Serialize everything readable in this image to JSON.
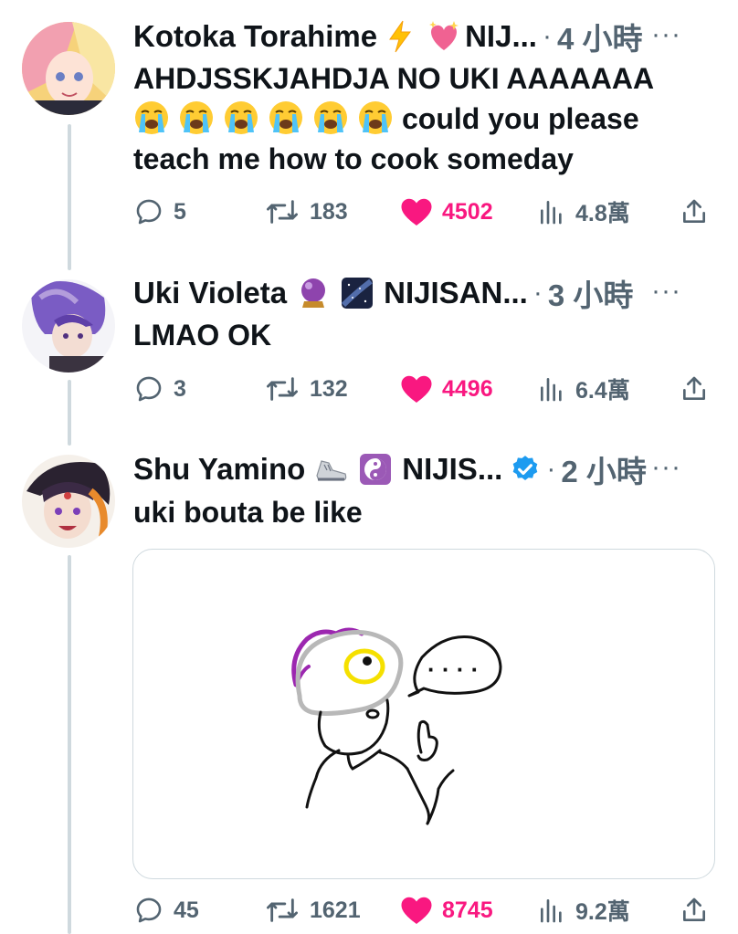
{
  "tweets": [
    {
      "name": "Kotoka Torahime",
      "badges": [
        "lightning-emoji",
        "sparkling-heart-emoji"
      ],
      "handle": "NIJ...",
      "dot": "·",
      "time": "4 小時",
      "more": "···",
      "text_line1": "AHDJSSKJAHDJA NO UKI AAAAAAA",
      "text_after_emojis": "could you please",
      "text_line3": "teach me how to cook someday",
      "emoji_count": 6,
      "replies": "5",
      "reposts": "183",
      "likes": "4502",
      "views": "4.8萬"
    },
    {
      "name": "Uki Violeta",
      "badges": [
        "crystal-ball-emoji",
        "milky-way-emoji"
      ],
      "handle": "NIJISAN...",
      "dot": "·",
      "time": "3 小時",
      "more": "···",
      "text": "LMAO OK",
      "replies": "3",
      "reposts": "132",
      "likes": "4496",
      "views": "6.4萬"
    },
    {
      "name": "Shu Yamino",
      "badges": [
        "running-shoe-emoji",
        "yin-yang-emoji"
      ],
      "handle": "NIJIS...",
      "verified": true,
      "dot": "·",
      "time": "2 小時",
      "more": "···",
      "text": "uki bouta be like",
      "media_speech_text": "· · · ·",
      "replies": "45",
      "reposts": "1621",
      "likes": "8745",
      "views": "9.2萬"
    }
  ],
  "colors": {
    "like": "#f91880",
    "secondary": "#536471",
    "thread_line": "#cfd9de",
    "verified": "#1d9bf0"
  }
}
